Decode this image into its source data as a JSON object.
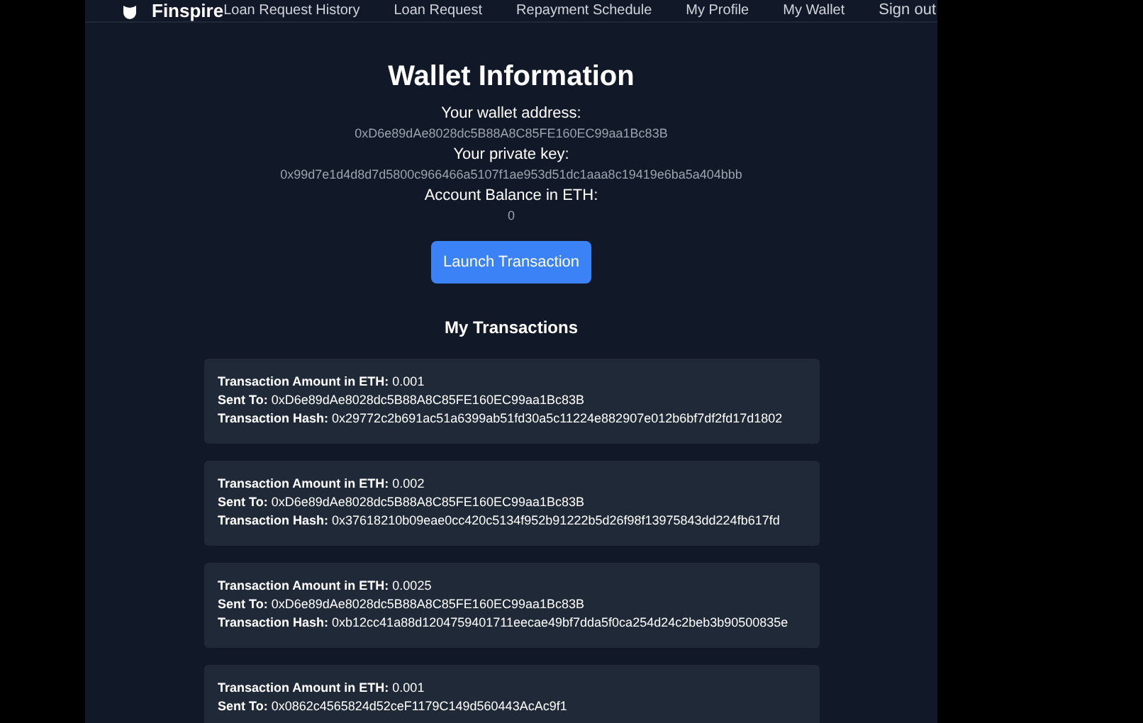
{
  "nav": {
    "brand": "Finspire",
    "links": [
      {
        "label": "Loan Request History"
      },
      {
        "label": "Loan Request"
      },
      {
        "label": "Repayment Schedule"
      },
      {
        "label": "My Profile"
      },
      {
        "label": "My Wallet"
      }
    ],
    "sign_out": "Sign out"
  },
  "title": "Wallet Information",
  "fields": [
    {
      "label": "Your wallet address:",
      "value": "0xD6e89dAe8028dc5B88A8C85FE160EC99aa1Bc83B"
    },
    {
      "label": "Your private key:",
      "value": "0x99d7e1d4d8d7d5800c966466a5107f1ae953d51dc1aaa8c19419e6ba5a404bbb"
    },
    {
      "label": "Account Balance in ETH:",
      "value": "0"
    }
  ],
  "button": "Launch Transaction",
  "transactions_title": "My Transactions",
  "transactions": [
    {
      "lines": [
        "**Transaction Amount in ETH:** 0.001",
        "**Sent To:** 0xD6e89dAe8028dc5B88A8C85FE160EC99aa1Bc83B",
        "**Transaction Hash:** 0x29772c2b691ac51a6399ab51fd30a5c11224e882907e012b6bf7df2fd17d1802"
      ]
    },
    {
      "lines": [
        "**Transaction Amount in ETH:** 0.002",
        "**Sent To:** 0xD6e89dAe8028dc5B88A8C85FE160EC99aa1Bc83B",
        "**Transaction Hash:** 0x37618210b09eae0cc420c5134f952b91222b5d26f98f13975843dd224fb617fd"
      ]
    },
    {
      "lines": [
        "**Transaction Amount in ETH:** 0.0025",
        "**Sent To:** 0xD6e89dAe8028dc5B88A8C85FE160EC99aa1Bc83B",
        "**Transaction Hash:** 0xb12cc41a88d1204759401711eecae49bf7dda5f0ca254d24c2beb3b90500835e"
      ]
    },
    {
      "lines": [
        "**Transaction Amount in ETH:** 0.001",
        "**Sent To:** 0x0862c4565824d52ceF1179C149d560443AcAc9f1"
      ]
    }
  ]
}
